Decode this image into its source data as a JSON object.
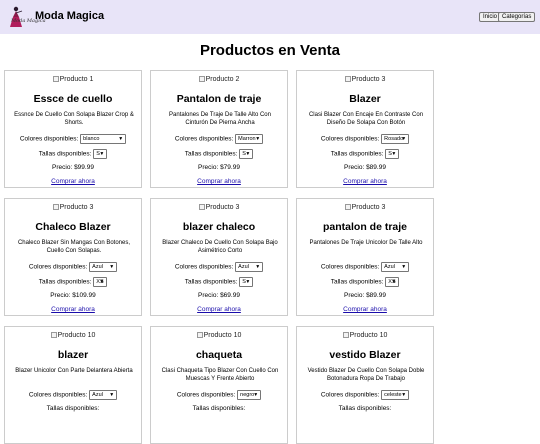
{
  "header": {
    "logo_text": "Moda Magica",
    "brand": "Moda Magica",
    "nav": [
      "Inicio",
      "Categorías"
    ]
  },
  "page_title": "Productos en Venta",
  "labels": {
    "colors": "Colores disponibles:",
    "sizes": "Tallas disponibles:",
    "buy": "Comprar ahora"
  },
  "products": [
    {
      "img_alt": "Producto 1",
      "name": "Essce de cuello",
      "desc": "Essnce De Cuello Con Solapa Blazer Crop & Shorts.",
      "color": "blanco",
      "size": "S",
      "price": "Precio: $99.99"
    },
    {
      "img_alt": "Producto 2",
      "name": "Pantalon de traje",
      "desc": "Pantalones De Traje De Talle Alto Con Cinturón De Pierna Ancha",
      "color": "Marron",
      "size": "S",
      "price": "Precio: $79.99"
    },
    {
      "img_alt": "Producto 3",
      "name": "Blazer",
      "desc": "Clasi Blazer Con Encaje En Contraste Con Diseño De Solapa Con Botón",
      "color": "Rosado",
      "size": "S",
      "price": "Precio: $89.99"
    },
    {
      "img_alt": "Producto 3",
      "name": "Chaleco Blazer",
      "desc": "Chaleco Blazer Sin Mangas Con Botones, Cuello Con Solapas.",
      "color": "Azul",
      "size": "XS",
      "price": "Precio: $109.99"
    },
    {
      "img_alt": "Producto 3",
      "name": "blazer chaleco",
      "desc": "Blazer Chaleco De Cuello Con Solapa Bajo Asimétrico Corto",
      "color": "Azul",
      "size": "S",
      "price": "Precio: $69.99"
    },
    {
      "img_alt": "Producto 3",
      "name": "pantalon de traje",
      "desc": "Pantalones De Traje Unicolor De Talle Alto",
      "color": "Azul",
      "size": "XS",
      "price": "Precio: $89.99"
    },
    {
      "img_alt": "Producto 10",
      "name": "blazer",
      "desc": "Blazer Unicolor Con Parte Delantera Abierta",
      "color": "Azul",
      "size": "",
      "price": ""
    },
    {
      "img_alt": "Producto 10",
      "name": "chaqueta",
      "desc": "Clasi Chaqueta Tipo Blazer Con Cuello Con Muescas Y Frente Abierto",
      "color": "negro",
      "size": "",
      "price": ""
    },
    {
      "img_alt": "Producto 10",
      "name": "vestido Blazer",
      "desc": "Vestido Blazer De Cuello Con Solapa Doble Botonadura Ropa De Trabajo",
      "color": "celeste",
      "size": "",
      "price": ""
    }
  ]
}
